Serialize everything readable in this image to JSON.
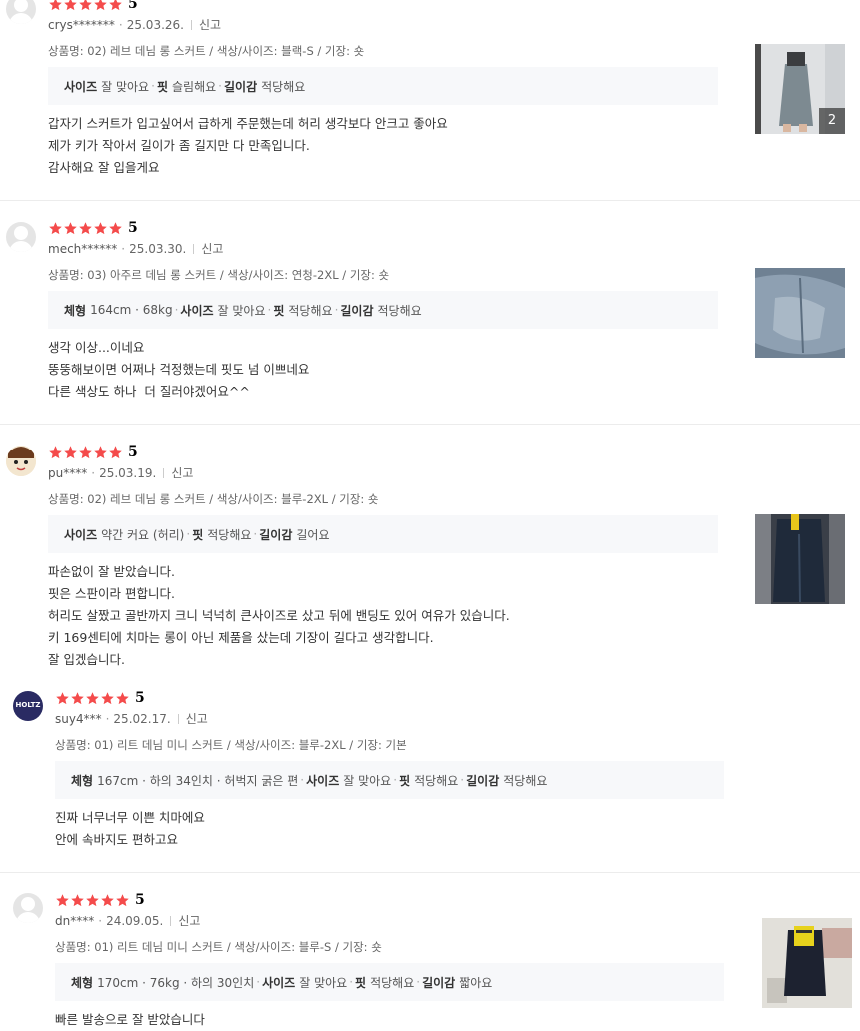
{
  "reviews": [
    {
      "score": "5",
      "user": "crys*******",
      "date": "25.03.26.",
      "report": "신고",
      "option": "상품명: 02) 레브 데님 롱 스커트 / 색상/사이즈: 블랙-S / 기장: 숏",
      "eval": [
        {
          "k": "사이즈",
          "v": "잘 맞아요"
        },
        {
          "k": "핏",
          "v": "슬림해요"
        },
        {
          "k": "길이감",
          "v": "적당해요"
        }
      ],
      "body": [
        "갑자기 스커트가 입고싶어서 급하게 주문했는데 허리 생각보다 안크고 좋아요",
        "제가 키가 작아서 길이가 좀 길지만 다 만족입니다.",
        "감사해요 잘 입을게요"
      ],
      "photo_count": "2"
    },
    {
      "score": "5",
      "user": "mech******",
      "date": "25.03.30.",
      "report": "신고",
      "option": "상품명: 03) 아주르 데님 롱 스커트 / 색상/사이즈: 연청-2XL / 기장: 숏",
      "eval": [
        {
          "k": "체형",
          "v": "164cm · 68kg"
        },
        {
          "k": "사이즈",
          "v": "잘 맞아요"
        },
        {
          "k": "핏",
          "v": "적당해요"
        },
        {
          "k": "길이감",
          "v": "적당해요"
        }
      ],
      "body": [
        "생각 이상...이네요",
        "뚱뚱해보이면 어쩌나 걱정했는데 핏도 넘 이쁘네요",
        "다른 색상도 하나  더 질러야겠어요^^"
      ]
    },
    {
      "score": "5",
      "user": "pu****",
      "date": "25.03.19.",
      "report": "신고",
      "option": "상품명: 02) 레브 데님 롱 스커트 / 색상/사이즈: 블루-2XL / 기장: 숏",
      "eval": [
        {
          "k": "사이즈",
          "v": "약간 커요 (허리)"
        },
        {
          "k": "핏",
          "v": "적당해요"
        },
        {
          "k": "길이감",
          "v": "길어요"
        }
      ],
      "body": [
        "파손없이 잘 받았습니다.",
        "핏은 스판이라 편합니다.",
        "허리도 살짰고 골반까지 크니 넉넉히 큰사이즈로 샀고 뒤에 밴딩도 있어 여유가 있습니다.",
        "키 169센티에 치마는 롱이 아닌 제품을 샀는데 기장이 길다고 생각합니다.",
        "잘 입겠습니다."
      ]
    },
    {
      "score": "5",
      "user": "suy4***",
      "date": "25.02.17.",
      "report": "신고",
      "avatar_text": "HOLTZ",
      "option": "상품명: 01) 리트 데님 미니 스커트 / 색상/사이즈: 블루-2XL / 기장: 기본",
      "eval": [
        {
          "k": "체형",
          "v": "167cm · 하의 34인치 · 허벅지 굵은 편"
        },
        {
          "k": "사이즈",
          "v": "잘 맞아요"
        },
        {
          "k": "핏",
          "v": "적당해요"
        },
        {
          "k": "길이감",
          "v": "적당해요"
        }
      ],
      "body": [
        "진짜 너무너무 이쁜 치마에요",
        "안에 속바지도 편하고요"
      ]
    },
    {
      "score": "5",
      "user": "dn****",
      "date": "24.09.05.",
      "report": "신고",
      "option": "상품명: 01) 리트 데님 미니 스커트 / 색상/사이즈: 블루-S / 기장: 숏",
      "eval": [
        {
          "k": "체형",
          "v": "170cm · 76kg · 하의 30인치"
        },
        {
          "k": "사이즈",
          "v": "잘 맞아요"
        },
        {
          "k": "핏",
          "v": "적당해요"
        },
        {
          "k": "길이감",
          "v": "짧아요"
        }
      ],
      "body": [
        "빠른 발송으로 잘 받았습니다"
      ]
    }
  ],
  "colors": {
    "star": "#f44b4b",
    "eval_bg": "#f7f8fa"
  }
}
